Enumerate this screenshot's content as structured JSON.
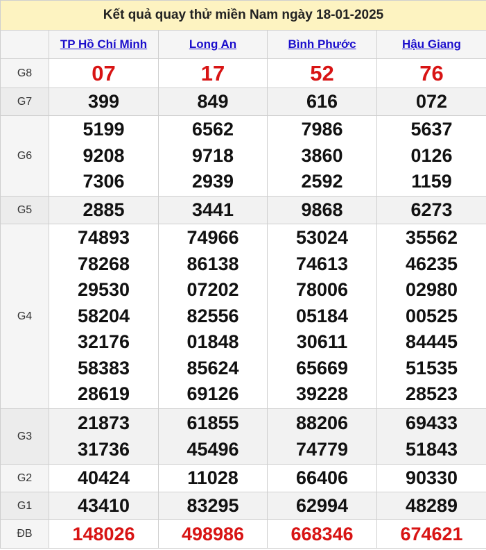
{
  "title": "Kết quả quay thử miền Nam ngày 18-01-2025",
  "provinces": [
    "TP Hồ Chí Minh",
    "Long An",
    "Bình Phước",
    "Hậu Giang"
  ],
  "prizes": [
    {
      "label": "G8",
      "values": [
        [
          "07"
        ],
        [
          "17"
        ],
        [
          "52"
        ],
        [
          "76"
        ]
      ]
    },
    {
      "label": "G7",
      "values": [
        [
          "399"
        ],
        [
          "849"
        ],
        [
          "616"
        ],
        [
          "072"
        ]
      ]
    },
    {
      "label": "G6",
      "values": [
        [
          "5199",
          "9208",
          "7306"
        ],
        [
          "6562",
          "9718",
          "2939"
        ],
        [
          "7986",
          "3860",
          "2592"
        ],
        [
          "5637",
          "0126",
          "1159"
        ]
      ]
    },
    {
      "label": "G5",
      "values": [
        [
          "2885"
        ],
        [
          "3441"
        ],
        [
          "9868"
        ],
        [
          "6273"
        ]
      ]
    },
    {
      "label": "G4",
      "values": [
        [
          "74893",
          "78268",
          "29530",
          "58204",
          "32176",
          "58383",
          "28619"
        ],
        [
          "74966",
          "86138",
          "07202",
          "82556",
          "01848",
          "85624",
          "69126"
        ],
        [
          "53024",
          "74613",
          "78006",
          "05184",
          "30611",
          "65669",
          "39228"
        ],
        [
          "35562",
          "46235",
          "02980",
          "00525",
          "84445",
          "51535",
          "28523"
        ]
      ]
    },
    {
      "label": "G3",
      "values": [
        [
          "21873",
          "31736"
        ],
        [
          "61855",
          "45496"
        ],
        [
          "88206",
          "74779"
        ],
        [
          "69433",
          "51843"
        ]
      ]
    },
    {
      "label": "G2",
      "values": [
        [
          "40424"
        ],
        [
          "11028"
        ],
        [
          "66406"
        ],
        [
          "90330"
        ]
      ]
    },
    {
      "label": "G1",
      "values": [
        [
          "43410"
        ],
        [
          "83295"
        ],
        [
          "62994"
        ],
        [
          "48289"
        ]
      ]
    },
    {
      "label": "ĐB",
      "values": [
        [
          "148026"
        ],
        [
          "498986"
        ],
        [
          "668346"
        ],
        [
          "674621"
        ]
      ]
    }
  ]
}
